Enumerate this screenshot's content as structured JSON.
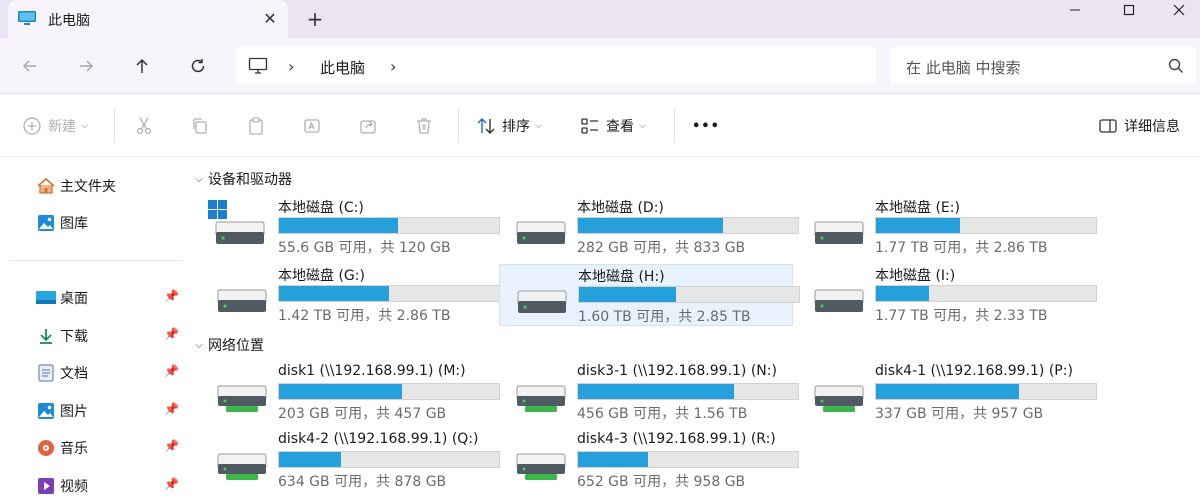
{
  "tab": {
    "title": "此电脑",
    "close": "✕",
    "new": "+"
  },
  "window": {
    "minimize": "—",
    "maximize": "☐",
    "close": "✕"
  },
  "address": {
    "location": "此电脑",
    "search_placeholder": "在 此电脑 中搜索"
  },
  "toolbar": {
    "new_label": "新建",
    "sort_label": "排序",
    "view_label": "查看",
    "more_label": "•••",
    "details_label": "详细信息"
  },
  "sidebar": {
    "items": [
      {
        "label": "主文件夹",
        "icon": "home-icon"
      },
      {
        "label": "图库",
        "icon": "gallery-icon"
      },
      {
        "label": "桌面",
        "icon": "desktop-icon"
      },
      {
        "label": "下载",
        "icon": "download-icon"
      },
      {
        "label": "文档",
        "icon": "documents-icon"
      },
      {
        "label": "图片",
        "icon": "pictures-icon"
      },
      {
        "label": "音乐",
        "icon": "music-icon"
      },
      {
        "label": "视频",
        "icon": "videos-icon"
      }
    ]
  },
  "sections": {
    "devices": "设备和驱动器",
    "network": "网络位置"
  },
  "drives": [
    {
      "name": "本地磁盘 (C:)",
      "info": "55.6 GB 可用，共 120 GB",
      "used": 0.54
    },
    {
      "name": "本地磁盘 (D:)",
      "info": "282 GB 可用，共 833 GB",
      "used": 0.66
    },
    {
      "name": "本地磁盘 (E:)",
      "info": "1.77 TB 可用，共 2.86 TB",
      "used": 0.38
    },
    {
      "name": "本地磁盘 (G:)",
      "info": "1.42 TB 可用，共 2.86 TB",
      "used": 0.5
    },
    {
      "name": "本地磁盘 (H:)",
      "info": "1.60 TB 可用，共 2.85 TB",
      "used": 0.44
    },
    {
      "name": "本地磁盘 (I:)",
      "info": "1.77 TB 可用，共 2.33 TB",
      "used": 0.24
    }
  ],
  "network_drives": [
    {
      "name": "disk1 (\\\\192.168.99.1) (M:)",
      "info": "203 GB 可用，共 457 GB",
      "used": 0.56
    },
    {
      "name": "disk3-1 (\\\\192.168.99.1) (N:)",
      "info": "456 GB 可用，共 1.56 TB",
      "used": 0.71
    },
    {
      "name": "disk4-1 (\\\\192.168.99.1) (P:)",
      "info": "337 GB 可用，共 957 GB",
      "used": 0.65
    },
    {
      "name": "disk4-2 (\\\\192.168.99.1) (Q:)",
      "info": "634 GB 可用，共 878 GB",
      "used": 0.28
    },
    {
      "name": "disk4-3 (\\\\192.168.99.1) (R:)",
      "info": "652 GB 可用，共 958 GB",
      "used": 0.32
    }
  ],
  "colors": {
    "accent": "#26a0da",
    "tabbar": "#ebe5f3",
    "selected": "#e8f2fc"
  }
}
